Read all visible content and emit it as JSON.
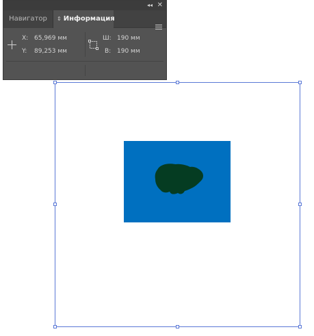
{
  "panel": {
    "tabs": {
      "navigator": "Навигатор",
      "info": "Информация"
    },
    "position": {
      "x_label": "X:",
      "x_value": "65,969 мм",
      "y_label": "Y:",
      "y_value": "89,253 мм"
    },
    "size": {
      "w_label": "Ш:",
      "w_value": "190 мм",
      "h_label": "В:",
      "h_value": "190 мм"
    },
    "icons": {
      "collapse": "double-chevron-left-icon",
      "close": "close-icon",
      "menu": "hamburger-menu-icon",
      "position": "crosshair-icon",
      "size": "bounding-box-icon",
      "tab_arrows": "up-down-arrows-icon"
    }
  },
  "artboard": {
    "selection_color": "#5a78d6",
    "rect_color": "#0070c0",
    "blob_color": "#053c22"
  }
}
